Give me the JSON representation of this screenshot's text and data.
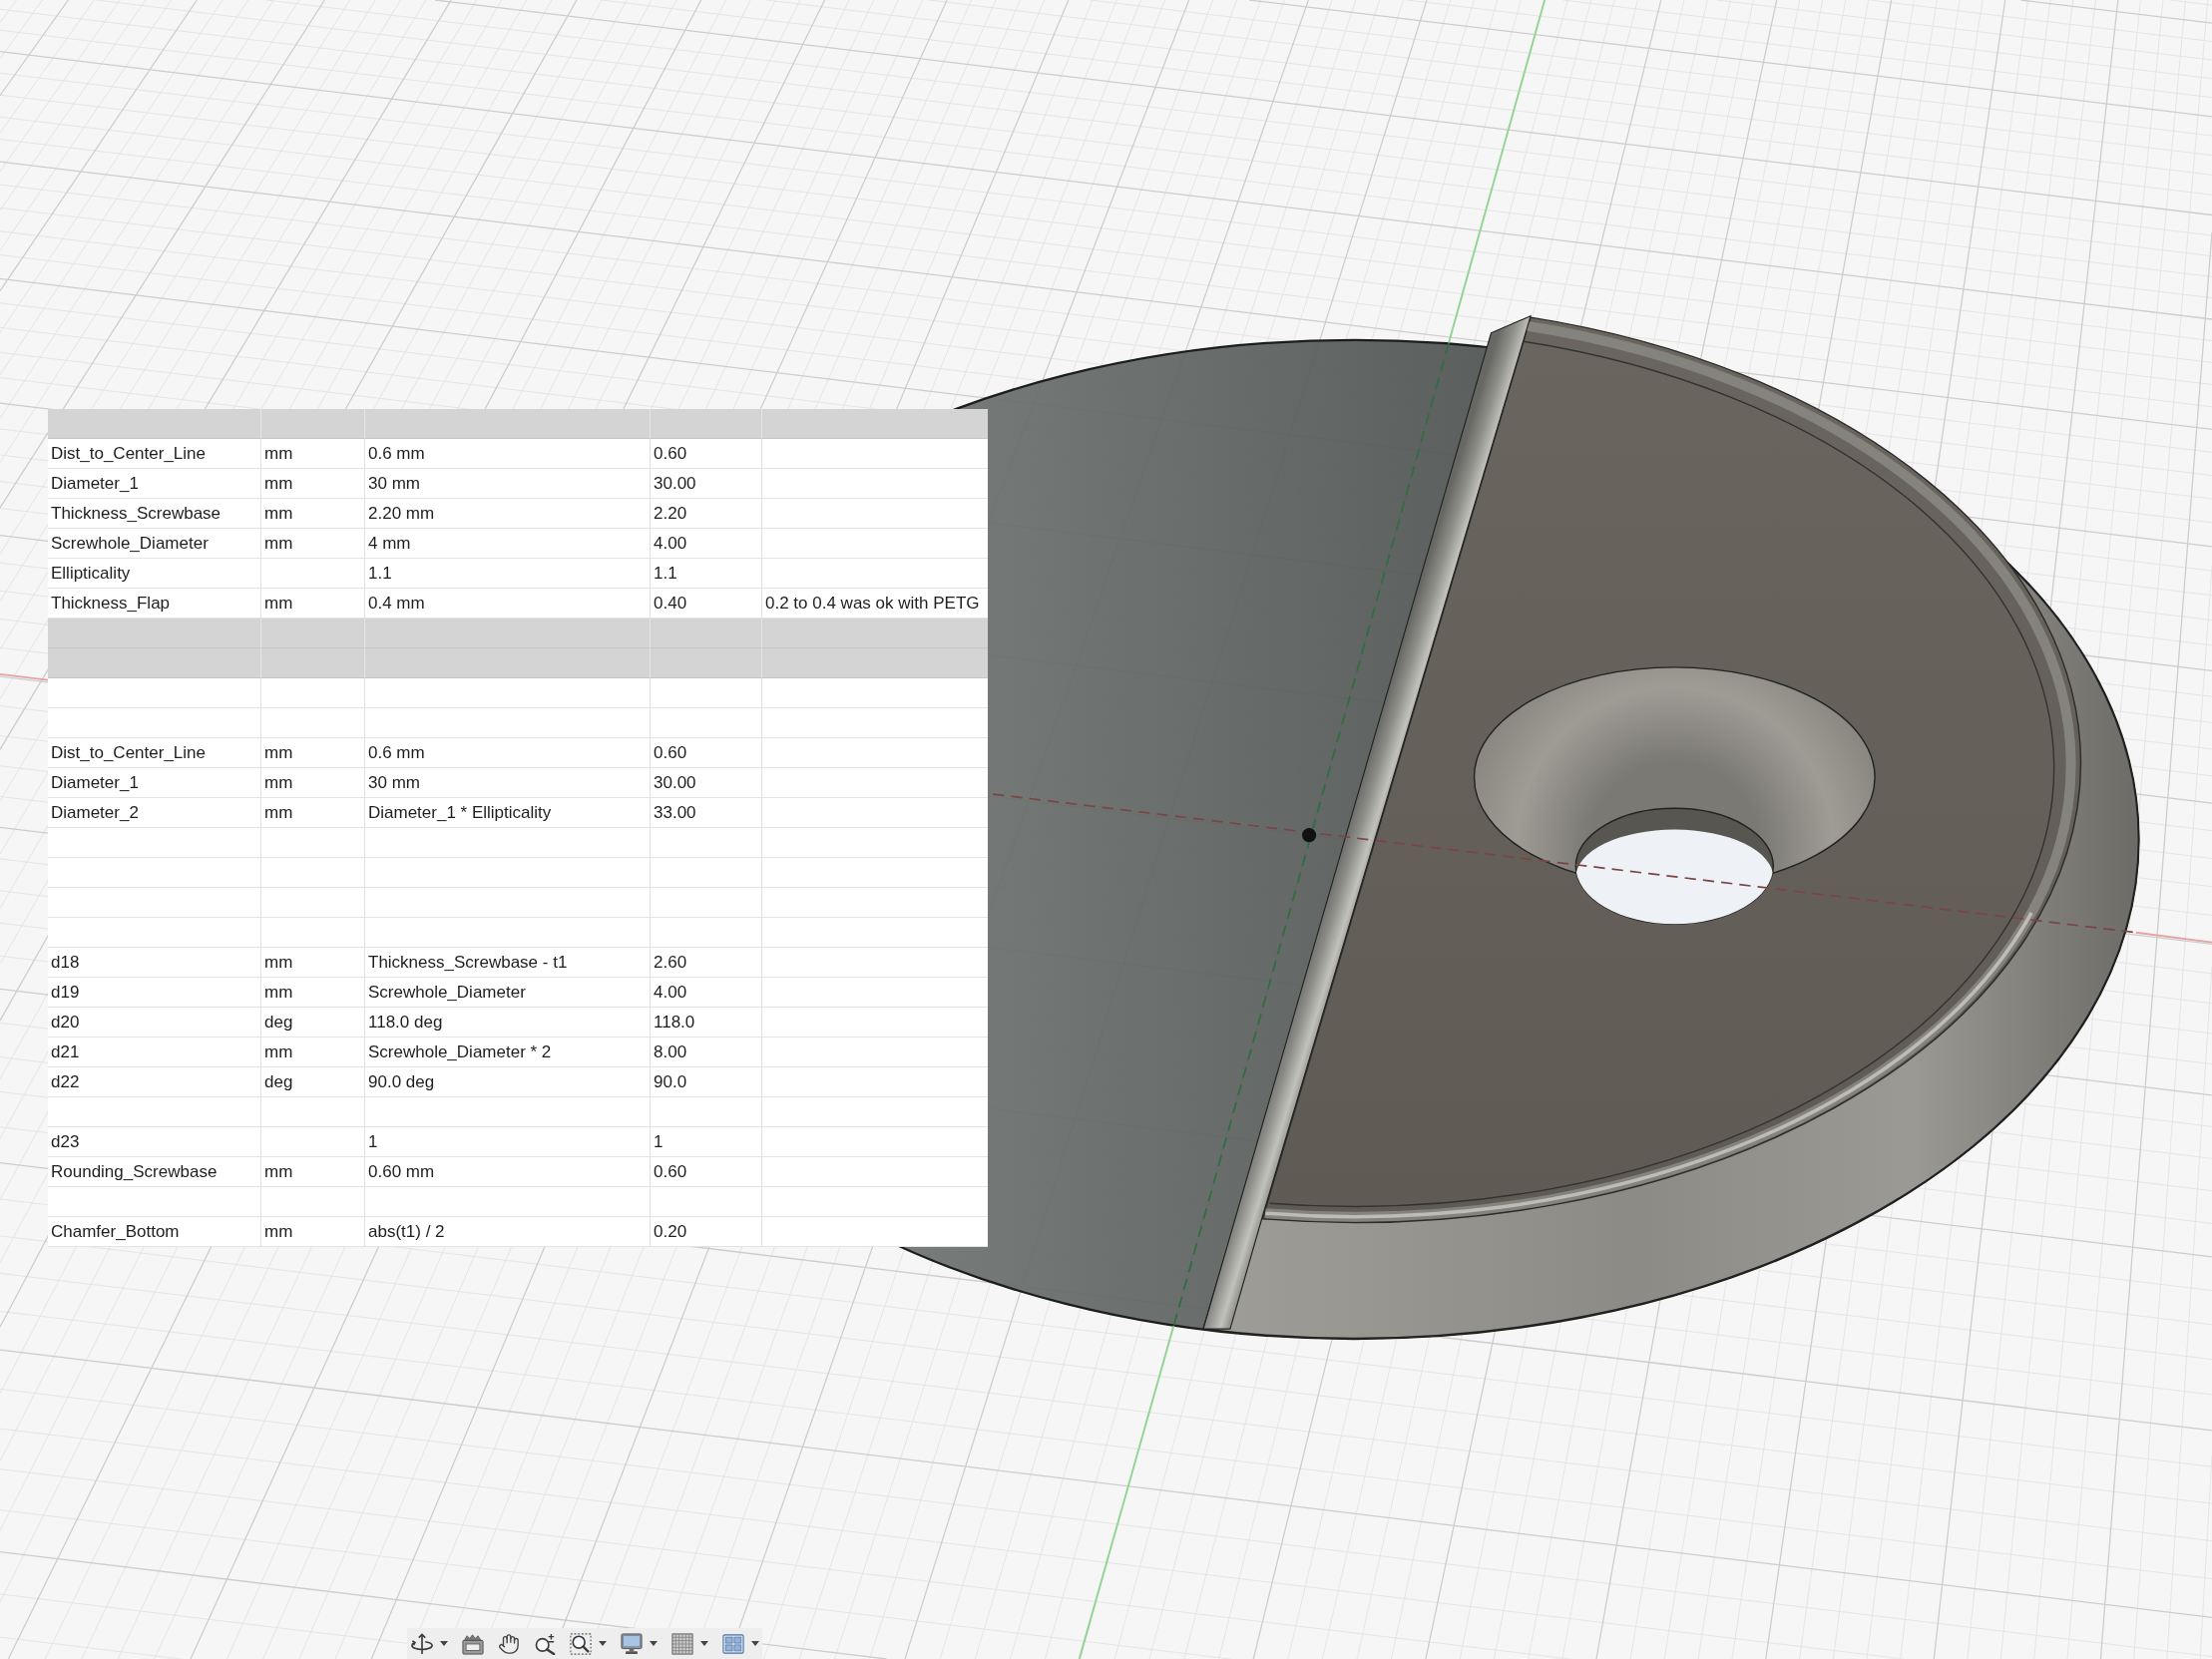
{
  "parameter_table": {
    "rows": [
      {
        "kind": "shaded"
      },
      {
        "kind": "plain",
        "column_1": "Dist_to_Center_Line",
        "column_2": "mm",
        "column_3": "0.6 mm",
        "column_4": "0.60"
      },
      {
        "kind": "plain",
        "column_1": "Diameter_1",
        "column_2": "mm",
        "column_3": "30 mm",
        "column_4": "30.00"
      },
      {
        "kind": "plain",
        "column_1": "Thickness_Screwbase",
        "column_2": "mm",
        "column_3": "2.20 mm",
        "column_4": "2.20"
      },
      {
        "kind": "plain",
        "column_1": "Screwhole_Diameter",
        "column_2": "mm",
        "column_3": "4 mm",
        "column_4": "4.00"
      },
      {
        "kind": "plain",
        "column_1": "Ellipticality",
        "column_3": "1.1",
        "column_4": "1.1"
      },
      {
        "kind": "plain",
        "column_1": "Thickness_Flap",
        "column_2": "mm",
        "column_3": "0.4 mm",
        "column_4": "0.40",
        "column_5": "0.2 to 0.4 was ok with PETG"
      },
      {
        "kind": "shaded"
      },
      {
        "kind": "shaded"
      },
      {
        "kind": "plain"
      },
      {
        "kind": "plain"
      },
      {
        "kind": "plain",
        "column_1": "Dist_to_Center_Line",
        "column_2": "mm",
        "column_3": "0.6 mm",
        "column_4": "0.60"
      },
      {
        "kind": "plain",
        "column_1": "Diameter_1",
        "column_2": "mm",
        "column_3": "30 mm",
        "column_4": "30.00"
      },
      {
        "kind": "plain",
        "column_1": "Diameter_2",
        "column_2": "mm",
        "column_3": "Diameter_1 * Ellipticality",
        "column_4": "33.00"
      },
      {
        "kind": "plain"
      },
      {
        "kind": "plain"
      },
      {
        "kind": "plain"
      },
      {
        "kind": "plain"
      },
      {
        "kind": "plain",
        "column_1": "d18",
        "column_2": "mm",
        "column_3": "Thickness_Screwbase - t1",
        "column_4": "2.60"
      },
      {
        "kind": "plain",
        "column_1": "d19",
        "column_2": "mm",
        "column_3": "Screwhole_Diameter",
        "column_4": "4.00"
      },
      {
        "kind": "plain",
        "column_1": "d20",
        "column_2": "deg",
        "column_3": "118.0 deg",
        "column_4": "118.0"
      },
      {
        "kind": "plain",
        "column_1": "d21",
        "column_2": "mm",
        "column_3": "Screwhole_Diameter * 2",
        "column_4": "8.00"
      },
      {
        "kind": "plain",
        "column_1": "d22",
        "column_2": "deg",
        "column_3": "90.0 deg",
        "column_4": "90.0"
      },
      {
        "kind": "plain"
      },
      {
        "kind": "plain",
        "column_1": "d23",
        "column_3": "1",
        "column_4": "1"
      },
      {
        "kind": "plain",
        "column_1": "Rounding_Screwbase",
        "column_2": "mm",
        "column_3": "0.60 mm",
        "column_4": "0.60"
      },
      {
        "kind": "plain"
      },
      {
        "kind": "plain",
        "column_1": "Chamfer_Bottom",
        "column_2": "mm",
        "column_3": "abs(t1) / 2",
        "column_4": "0.20"
      }
    ]
  },
  "view_toolbar": {
    "items": [
      {
        "kind": "orbit",
        "dropdown": true
      },
      {
        "kind": "look_at",
        "dropdown": false
      },
      {
        "kind": "pan",
        "dropdown": false
      },
      {
        "kind": "zoom",
        "dropdown": false
      },
      {
        "kind": "zoom_window",
        "dropdown": true
      },
      {
        "kind": "display",
        "dropdown": true
      },
      {
        "kind": "grid",
        "dropdown": true
      },
      {
        "kind": "viewports",
        "dropdown": true
      }
    ]
  }
}
